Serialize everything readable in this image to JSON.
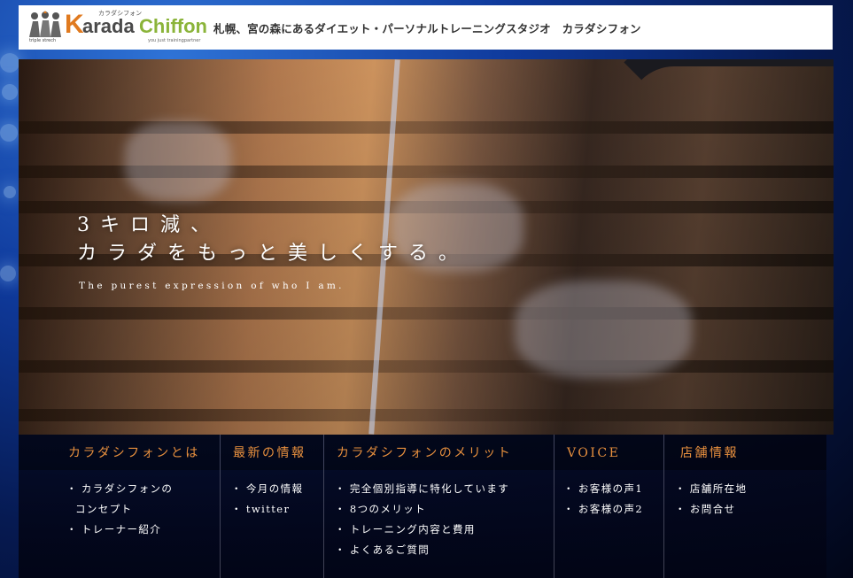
{
  "header": {
    "logo": {
      "brand_kana": "カラダシフォン",
      "brand_first": "K",
      "brand_rest": "arada",
      "brand_second": "Chiffon",
      "tag_left": "triple strech",
      "tag_right": "you just trainingpartner"
    },
    "site_title": "札幌、宮の森にあるダイエット・パーソナルトレーニングスタジオ　カラダシフォン"
  },
  "hero": {
    "headline_1": "3キロ減、",
    "headline_2": "カラダをもっと美しくする。",
    "subline": "The purest expression of who I am."
  },
  "nav": {
    "columns": [
      {
        "title": "カラダシフォンとは",
        "items": [
          "カラダシフォンの",
          "トレーナー紹介"
        ],
        "item_continuation": "コンセプト"
      },
      {
        "title": "最新の情報",
        "items": [
          "今月の情報",
          "twitter"
        ]
      },
      {
        "title": "カラダシフォンのメリット",
        "items": [
          "完全個別指導に特化しています",
          "8つのメリット",
          "トレーニング内容と費用",
          "よくあるご質問"
        ]
      },
      {
        "title": "VOICE",
        "items": [
          "お客様の声1",
          "お客様の声2"
        ]
      },
      {
        "title": "店舗情報",
        "items": [
          "店舗所在地",
          "お問合せ"
        ]
      }
    ],
    "bullet": "・"
  }
}
